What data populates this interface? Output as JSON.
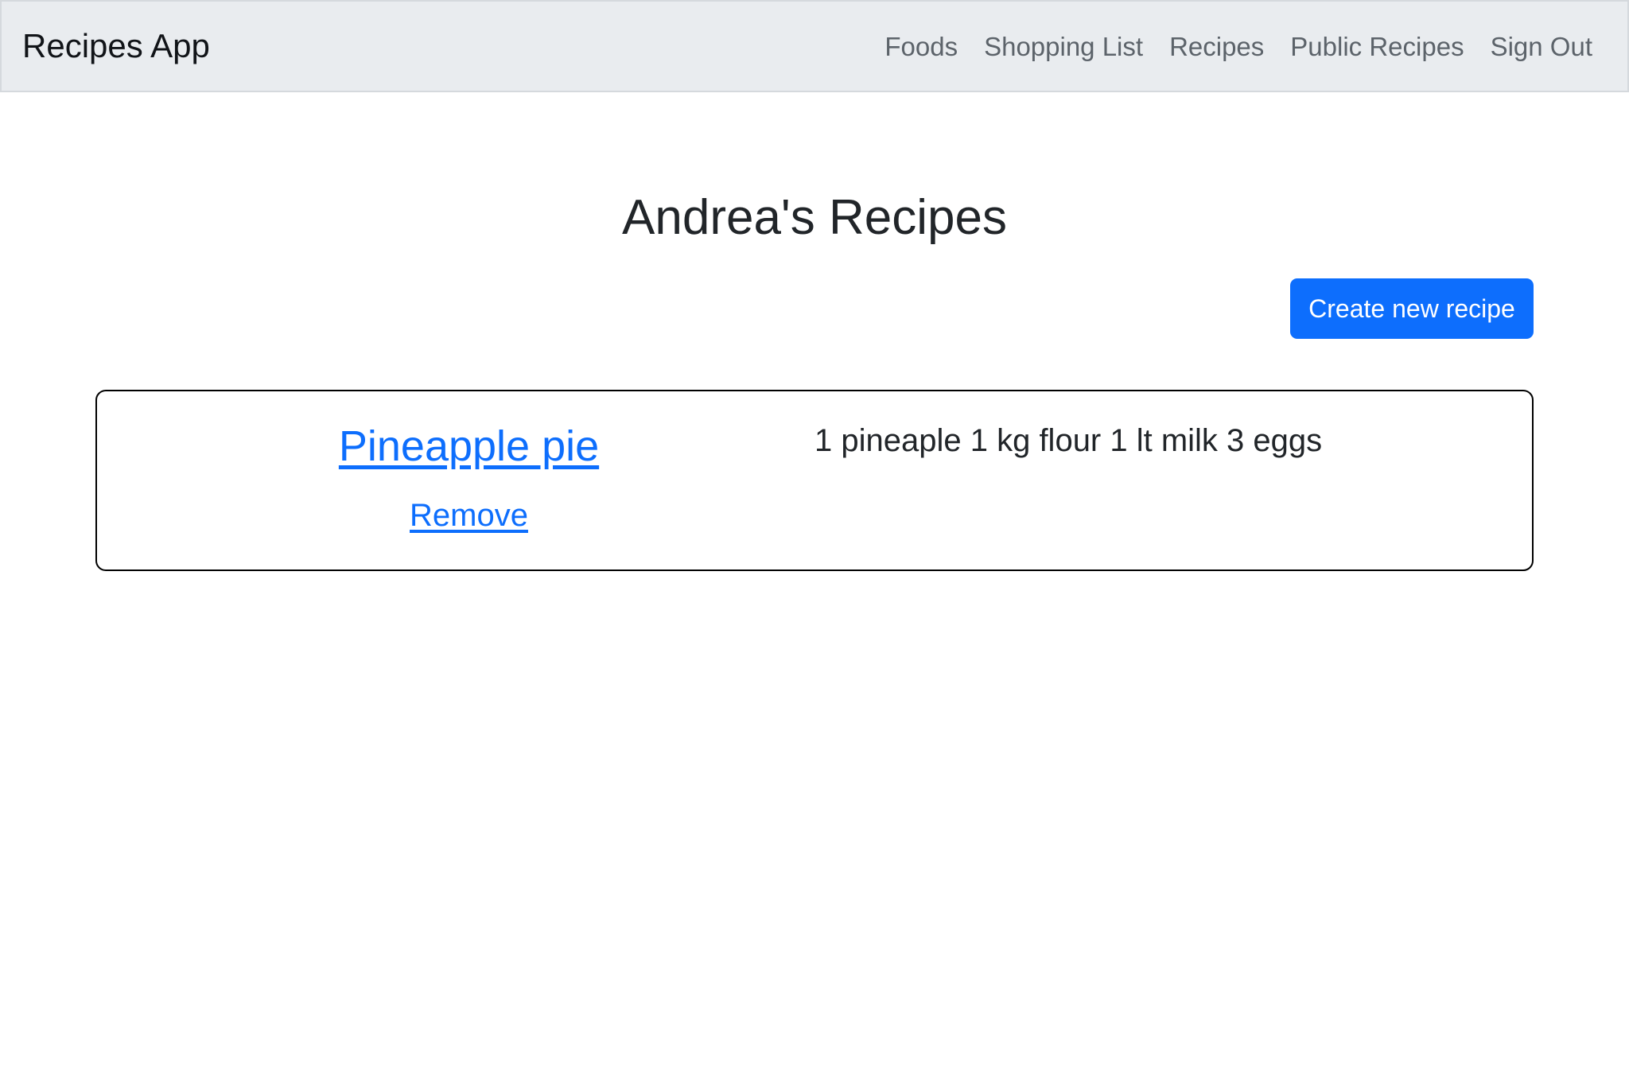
{
  "navbar": {
    "brand": "Recipes App",
    "links": [
      {
        "label": "Foods"
      },
      {
        "label": "Shopping List"
      },
      {
        "label": "Recipes"
      },
      {
        "label": "Public Recipes"
      },
      {
        "label": "Sign Out"
      }
    ]
  },
  "main": {
    "title": "Andrea's Recipes",
    "create_button_label": "Create new recipe",
    "recipes": [
      {
        "name": "Pineapple pie",
        "remove_label": "Remove",
        "description": "1 pineaple 1 kg flour 1 lt milk 3 eggs"
      }
    ]
  },
  "colors": {
    "navbar_bg": "#e9ecef",
    "primary": "#0d6efd",
    "text": "#212529",
    "nav_link": "#5c636a"
  }
}
